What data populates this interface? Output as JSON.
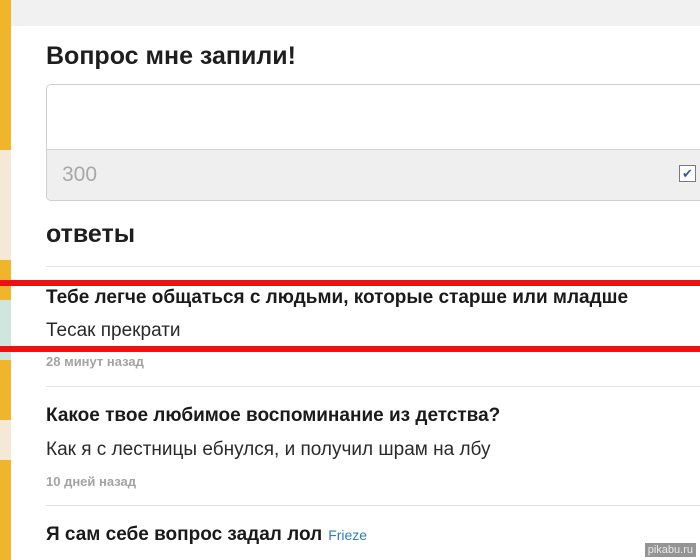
{
  "ask": {
    "title": "Вопрос мне запили!",
    "char_counter": "300",
    "anonymous_checked": true
  },
  "answers": {
    "heading": "ответы",
    "items": [
      {
        "question": "Тебе легче общаться с людьми, которые старше или младше",
        "answer": "Тесак прекрати",
        "time": "28 минут назад"
      },
      {
        "question": "Какое твое любимое воспоминание из детства?",
        "answer": "Как я с лестницы ебнулся, и получил шрам на лбу",
        "time": "10 дней назад"
      },
      {
        "question": "Я сам себе вопрос задал лол",
        "author": "Frieze"
      }
    ]
  },
  "highlight_color": "#ee1111",
  "watermark": "pikabu.ru"
}
